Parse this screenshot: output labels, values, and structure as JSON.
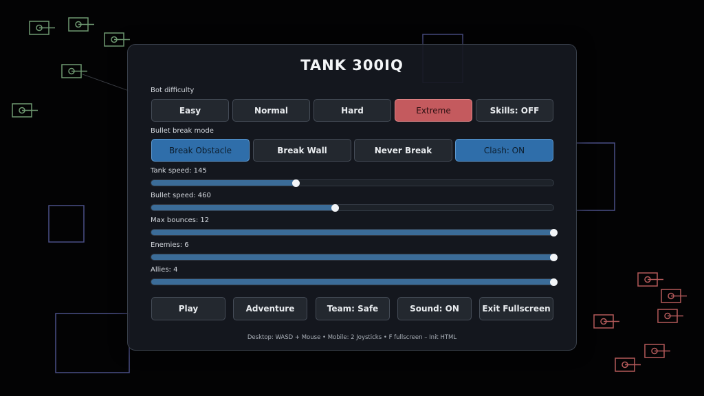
{
  "title": "TANK 300IQ",
  "difficulty": {
    "label": "Bot difficulty",
    "options": [
      "Easy",
      "Normal",
      "Hard",
      "Extreme"
    ],
    "selected": "Extreme",
    "skills_label": "Skills: OFF"
  },
  "bullet": {
    "label": "Bullet break mode",
    "options": [
      "Break Obstacle",
      "Break Wall",
      "Never Break"
    ],
    "selected": "Break Obstacle",
    "clash_label": "Clash: ON"
  },
  "sliders": [
    {
      "label": "Tank speed: 145",
      "fraction": 0.36
    },
    {
      "label": "Bullet speed: 460",
      "fraction": 0.458
    },
    {
      "label": "Max bounces: 12",
      "fraction": 1.0
    },
    {
      "label": "Enemies: 6",
      "fraction": 1.0
    },
    {
      "label": "Allies: 4",
      "fraction": 1.0
    }
  ],
  "actions": {
    "play": "Play",
    "adventure": "Adventure",
    "team": "Team: Safe",
    "sound": "Sound: ON",
    "fullscreen": "Exit Fullscreen"
  },
  "footer": "Desktop: WASD + Mouse • Mobile: 2 Joysticks • F fullscreen – Init HTML",
  "colors": {
    "background": "#030304",
    "panel": "#151920",
    "active_red": "#c45a5e",
    "active_blue": "#2f6eaa",
    "slider_fill": "#3b6c98",
    "ally_tank": "#6f9a72",
    "enemy_tank": "#b45a5a",
    "obstacle": "#4b4f86"
  }
}
